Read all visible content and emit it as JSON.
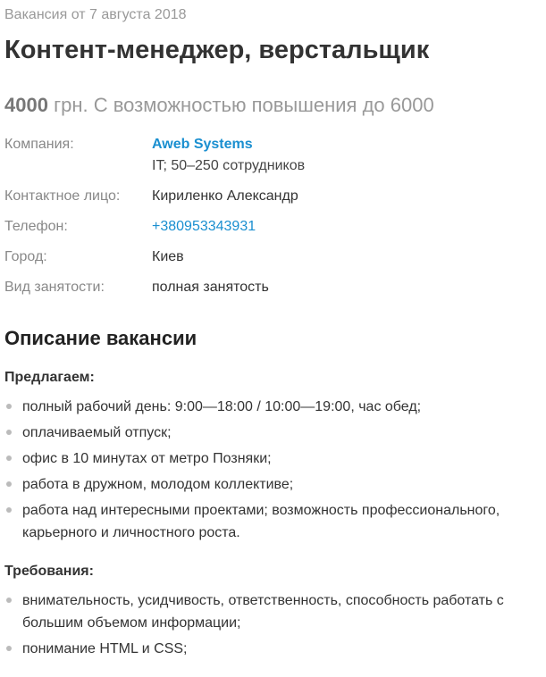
{
  "header": {
    "posted": "Вакансия от 7 августа 2018",
    "title": "Контент-менеджер, верстальщик",
    "salary_amount": "4000",
    "salary_rest": " грн. С возможностью повышения до 6000"
  },
  "details": {
    "company_label": "Компания:",
    "company_name": "Aweb Systems",
    "company_info": "IT; 50–250 сотрудников",
    "contact_label": "Контактное лицо:",
    "contact_value": "Кириленко Александр",
    "phone_label": "Телефон:",
    "phone_value": "+380953343931",
    "city_label": "Город:",
    "city_value": "Киев",
    "employment_label": "Вид занятости:",
    "employment_value": "полная занятость"
  },
  "description": {
    "title": "Описание вакансии",
    "offer_title": "Предлагаем:",
    "offer_items": [
      "полный рабочий день: 9:00—18:00 / 10:00—19:00, час обед;",
      "оплачиваемый отпуск;",
      "офис в 10 минутах от метро Позняки;",
      "работа в дружном, молодом коллективе;",
      "работа над интересными проектами; возможность профессионального, карьерного и личностного роста."
    ],
    "req_title": "Требования:",
    "req_items": [
      "внимательность, усидчивость, ответственность, способность работать с большим объемом информации;",
      "понимание HTML и CSS;"
    ]
  },
  "colors": {
    "link": "#1a8fd0",
    "muted": "#999999",
    "text": "#333333"
  }
}
